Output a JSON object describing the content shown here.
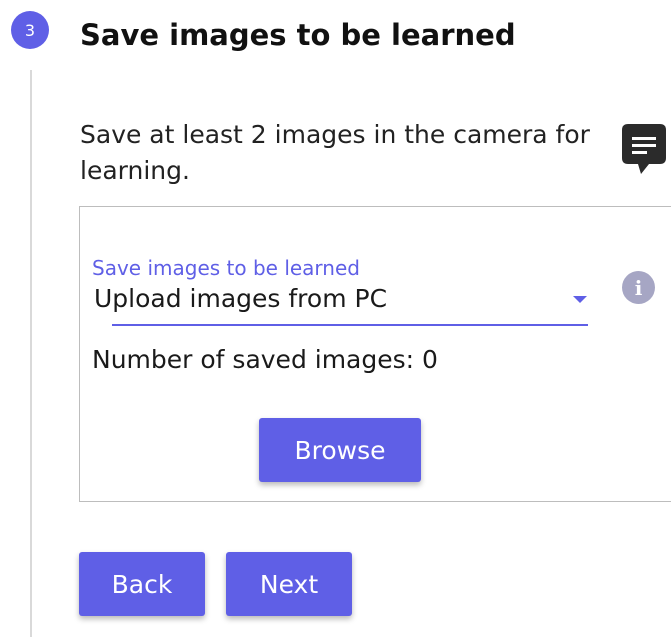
{
  "step": {
    "number": "3",
    "title": "Save images to be learned",
    "instruction": "Save at least 2 images in the camera for learning."
  },
  "source_field": {
    "label": "Save images to be learned",
    "selected": "Upload images from PC"
  },
  "saved_images": {
    "text": "Number of saved images: 0"
  },
  "buttons": {
    "browse": "Browse",
    "back": "Back",
    "next": "Next"
  },
  "icons": {
    "help": "chat-bubble-icon",
    "info": "info-icon",
    "dropdown": "caret-down-icon",
    "info_glyph": "i"
  },
  "colors": {
    "accent": "#5f5fe6",
    "info_icon": "#a6a6c4",
    "chat_icon": "#2b2b2b"
  }
}
